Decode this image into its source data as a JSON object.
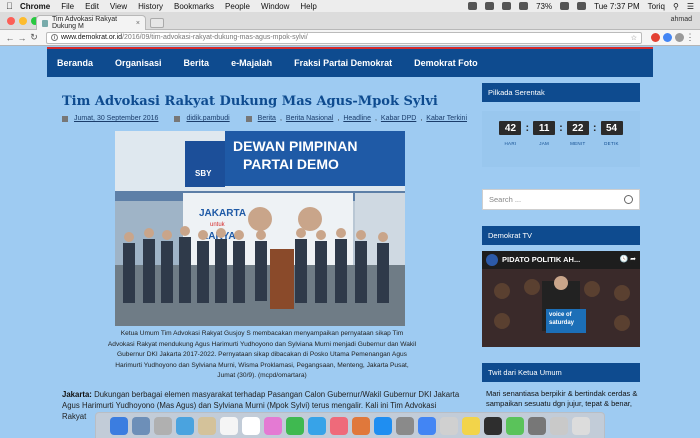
{
  "menubar": {
    "apple": "",
    "items": [
      "Chrome",
      "File",
      "Edit",
      "View",
      "History",
      "Bookmarks",
      "People",
      "Window",
      "Help"
    ],
    "battery": "73%",
    "time": "Tue 7:37 PM",
    "user": "Toriq"
  },
  "browser": {
    "tab_title": "Tim Advokasi Rakyat Dukung M",
    "profile": "ahmad",
    "url_host": "www.demokrat.or.id",
    "url_path": "/2016/09/tim-advokasi-rakyat-dukung-mas-agus-mpok-sylvi/"
  },
  "nav": [
    "Beranda",
    "Organisasi",
    "Berita",
    "e-Majalah",
    "Fraksi Partai Demokrat",
    "Demokrat Foto"
  ],
  "article": {
    "title": "Tim Advokasi Rakyat Dukung Mas Agus-Mpok Sylvi",
    "date": "Jumat, 30 September 2016",
    "author": "didik.pambudi",
    "tags": [
      "Berita",
      "Berita Nasional",
      "Headline",
      "Kabar DPD",
      "Kabar Terkini"
    ],
    "photo_banner_1": "DEWAN PIMPINAN",
    "photo_banner_2": "PARTAI DEMO",
    "photo_sby": "SBY",
    "photo_jakarta": "JAKARTA",
    "photo_untuk": "untuk",
    "photo_rakyat": "RAKYAT",
    "caption": "Ketua Umum Tim Advokasi Rakyat Gusjoy S membacakan menyampaikan pernyataan sikap Tim Advokasi Rakyat mendukung Agus Harimurti Yudhoyono dan Sylviana Murni menjadi Gubernur dan Wakil Gubernur DKI Jakarta 2017-2022. Pernyataan sikap dibacakan di Posko Utama Pemenangan Agus Harimurti Yudhoyono dan Sylviana Murni, Wisma Proklamasi, Pegangsaan, Menteng, Jakarta Pusat, Jumat (30/9). (mcpd/omartara)",
    "lead_label": "Jakarta:",
    "lead_text": "Dukungan berbagai elemen masyarakat terhadap Pasangan Calon Gubernur/Wakil Gubernur DKI Jakarta Agus Harimurti Yudhoyono (Mas Agus) dan Sylviana Murni (Mpok Sylvi) terus mengalir. Kali ini Tim Advokasi Rakyat"
  },
  "sidebar": {
    "pilkada_title": "Pilkada Serentak",
    "countdown": {
      "hari": "42",
      "jam": "11",
      "menit": "22",
      "detik": "54",
      "labels": [
        "HARI",
        "JAM",
        "MENIT",
        "DETIK"
      ]
    },
    "search_placeholder": "Search ...",
    "tv_title": "Demokrat TV",
    "video_title": "PIDATO POLITIK AH...",
    "video_badge": "voice of saturday",
    "twitter_title": "Twit dari Ketua Umum",
    "tweet": "Mari senantiasa berpikir & bertindak cerdas & sampaikan sesuatu dgn jujur, tepat & benar,"
  },
  "colors": {
    "nav_bg": "#0e4b8f",
    "page_bg": "#9ecbf2",
    "accent_red": "#d62b2b"
  }
}
